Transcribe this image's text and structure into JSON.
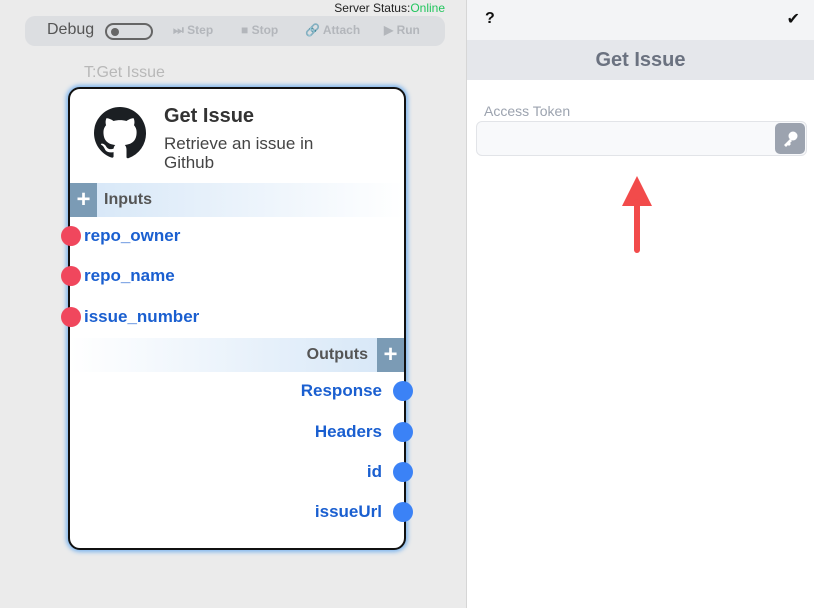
{
  "server_status": {
    "label": "Server Status:",
    "value": "Online"
  },
  "toolbar": {
    "debug": "Debug",
    "step": "Step",
    "stop": "Stop",
    "attach": "Attach",
    "run": "Run"
  },
  "node": {
    "tag": "T:Get Issue",
    "title": "Get Issue",
    "description": "Retrieve an issue in Github",
    "inputs_label": "Inputs",
    "outputs_label": "Outputs",
    "inputs": [
      "repo_owner",
      "repo_name",
      "issue_number"
    ],
    "outputs": [
      "Response",
      "Headers",
      "id",
      "issueUrl"
    ]
  },
  "panel": {
    "help": "?",
    "confirm": "✔",
    "title": "Get Issue",
    "field_label": "Access Token",
    "field_value": ""
  }
}
